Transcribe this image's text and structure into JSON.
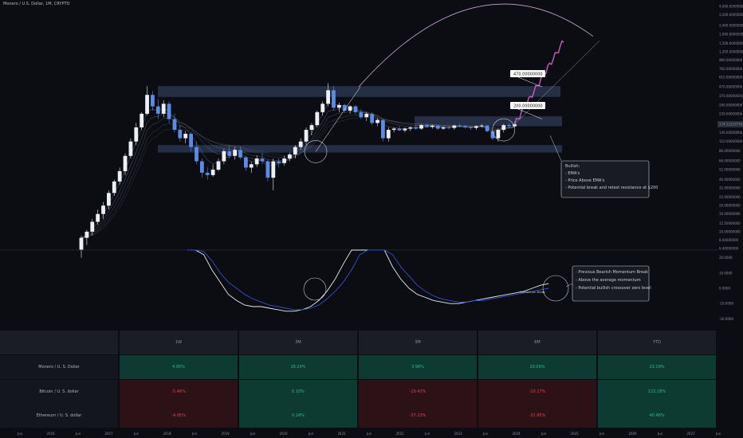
{
  "header": {
    "symbol_label": "Monero / U.S. Dollar, 1M, CRYPTO"
  },
  "chart_data": {
    "type": "candlestick",
    "price_axis_labels": [
      "4,000.00000000",
      "3,200.00000000",
      "2,400.00000000",
      "1,900.00000000",
      "1,500.00000000",
      "1,200.00000000",
      "960.00000000",
      "760.00000000",
      "610.00000000",
      "470.00000000",
      "370.00000000",
      "290.00000000",
      "230.00000000",
      "180.00000000",
      "140.00000000",
      "110.00000000",
      "86.00000000",
      "66.00000000",
      "52.00000000",
      "40.00000000",
      "32.00000000",
      "25.00000000",
      "20.00000000",
      "16.00000000",
      "12.50000000",
      "10.00000000",
      "8.00000000",
      "6.40000000"
    ],
    "current_price_label": "174.11219776",
    "time_axis_labels": [
      "Jun",
      "2016",
      "Jun",
      "2017",
      "Jun",
      "2018",
      "Jun",
      "2019",
      "Jun",
      "2020",
      "Jun",
      "2021",
      "Jun",
      "2022",
      "Jun",
      "2023",
      "Jun",
      "2024",
      "Jun",
      "2025",
      "Jun",
      "2026",
      "Jun",
      "2027",
      "Jun"
    ],
    "levels": [
      {
        "label": "470.00000000",
        "price": 470
      },
      {
        "label": "200.00000000",
        "price": 200
      }
    ],
    "candles": [
      {
        "o": 6.2,
        "h": 9,
        "l": 5,
        "c": 8.5
      },
      {
        "o": 8.5,
        "h": 10.5,
        "l": 7,
        "c": 10
      },
      {
        "o": 10,
        "h": 14,
        "l": 9,
        "c": 13
      },
      {
        "o": 13,
        "h": 18,
        "l": 12,
        "c": 16
      },
      {
        "o": 16,
        "h": 22,
        "l": 14,
        "c": 20
      },
      {
        "o": 20,
        "h": 30,
        "l": 18,
        "c": 28
      },
      {
        "o": 28,
        "h": 40,
        "l": 26,
        "c": 38
      },
      {
        "o": 38,
        "h": 55,
        "l": 35,
        "c": 50
      },
      {
        "o": 50,
        "h": 80,
        "l": 45,
        "c": 75
      },
      {
        "o": 75,
        "h": 120,
        "l": 70,
        "c": 110
      },
      {
        "o": 110,
        "h": 180,
        "l": 100,
        "c": 160
      },
      {
        "o": 160,
        "h": 240,
        "l": 150,
        "c": 230
      },
      {
        "o": 230,
        "h": 480,
        "l": 220,
        "c": 380
      },
      {
        "o": 380,
        "h": 420,
        "l": 250,
        "c": 280
      },
      {
        "o": 280,
        "h": 340,
        "l": 200,
        "c": 230
      },
      {
        "o": 230,
        "h": 330,
        "l": 210,
        "c": 300
      },
      {
        "o": 300,
        "h": 320,
        "l": 180,
        "c": 200
      },
      {
        "o": 200,
        "h": 230,
        "l": 140,
        "c": 150
      },
      {
        "o": 150,
        "h": 170,
        "l": 110,
        "c": 120
      },
      {
        "o": 120,
        "h": 145,
        "l": 105,
        "c": 135
      },
      {
        "o": 135,
        "h": 140,
        "l": 85,
        "c": 95
      },
      {
        "o": 95,
        "h": 110,
        "l": 60,
        "c": 65
      },
      {
        "o": 65,
        "h": 70,
        "l": 42,
        "c": 48
      },
      {
        "o": 48,
        "h": 56,
        "l": 40,
        "c": 45
      },
      {
        "o": 45,
        "h": 60,
        "l": 43,
        "c": 52
      },
      {
        "o": 52,
        "h": 70,
        "l": 50,
        "c": 65
      },
      {
        "o": 65,
        "h": 90,
        "l": 60,
        "c": 85
      },
      {
        "o": 85,
        "h": 100,
        "l": 70,
        "c": 75
      },
      {
        "o": 75,
        "h": 95,
        "l": 68,
        "c": 88
      },
      {
        "o": 88,
        "h": 96,
        "l": 68,
        "c": 72
      },
      {
        "o": 72,
        "h": 76,
        "l": 50,
        "c": 55
      },
      {
        "o": 55,
        "h": 64,
        "l": 48,
        "c": 60
      },
      {
        "o": 60,
        "h": 76,
        "l": 56,
        "c": 70
      },
      {
        "o": 70,
        "h": 82,
        "l": 60,
        "c": 65
      },
      {
        "o": 65,
        "h": 68,
        "l": 38,
        "c": 42
      },
      {
        "o": 42,
        "h": 70,
        "l": 30,
        "c": 65
      },
      {
        "o": 65,
        "h": 70,
        "l": 55,
        "c": 62
      },
      {
        "o": 62,
        "h": 75,
        "l": 58,
        "c": 70
      },
      {
        "o": 70,
        "h": 82,
        "l": 65,
        "c": 78
      },
      {
        "o": 78,
        "h": 100,
        "l": 70,
        "c": 95
      },
      {
        "o": 95,
        "h": 120,
        "l": 88,
        "c": 110
      },
      {
        "o": 110,
        "h": 160,
        "l": 100,
        "c": 150
      },
      {
        "o": 150,
        "h": 180,
        "l": 130,
        "c": 170
      },
      {
        "o": 170,
        "h": 250,
        "l": 160,
        "c": 240
      },
      {
        "o": 240,
        "h": 320,
        "l": 220,
        "c": 300
      },
      {
        "o": 300,
        "h": 520,
        "l": 280,
        "c": 430
      },
      {
        "o": 430,
        "h": 480,
        "l": 250,
        "c": 270
      },
      {
        "o": 270,
        "h": 310,
        "l": 240,
        "c": 290
      },
      {
        "o": 290,
        "h": 300,
        "l": 240,
        "c": 250
      },
      {
        "o": 250,
        "h": 290,
        "l": 230,
        "c": 280
      },
      {
        "o": 280,
        "h": 290,
        "l": 225,
        "c": 240
      },
      {
        "o": 240,
        "h": 260,
        "l": 200,
        "c": 210
      },
      {
        "o": 210,
        "h": 240,
        "l": 190,
        "c": 230
      },
      {
        "o": 230,
        "h": 240,
        "l": 170,
        "c": 180
      },
      {
        "o": 180,
        "h": 205,
        "l": 165,
        "c": 195
      },
      {
        "o": 195,
        "h": 200,
        "l": 110,
        "c": 120
      },
      {
        "o": 120,
        "h": 160,
        "l": 110,
        "c": 150
      },
      {
        "o": 150,
        "h": 160,
        "l": 140,
        "c": 155
      },
      {
        "o": 155,
        "h": 165,
        "l": 145,
        "c": 148
      },
      {
        "o": 148,
        "h": 160,
        "l": 140,
        "c": 155
      },
      {
        "o": 155,
        "h": 165,
        "l": 145,
        "c": 160
      },
      {
        "o": 160,
        "h": 168,
        "l": 150,
        "c": 155
      },
      {
        "o": 155,
        "h": 175,
        "l": 150,
        "c": 170
      },
      {
        "o": 170,
        "h": 178,
        "l": 158,
        "c": 162
      },
      {
        "o": 162,
        "h": 172,
        "l": 155,
        "c": 168
      },
      {
        "o": 168,
        "h": 172,
        "l": 150,
        "c": 155
      },
      {
        "o": 155,
        "h": 165,
        "l": 150,
        "c": 160
      },
      {
        "o": 160,
        "h": 168,
        "l": 152,
        "c": 158
      },
      {
        "o": 158,
        "h": 172,
        "l": 150,
        "c": 168
      },
      {
        "o": 168,
        "h": 176,
        "l": 160,
        "c": 165
      },
      {
        "o": 165,
        "h": 170,
        "l": 155,
        "c": 160
      },
      {
        "o": 160,
        "h": 168,
        "l": 150,
        "c": 158
      },
      {
        "o": 158,
        "h": 170,
        "l": 150,
        "c": 165
      },
      {
        "o": 165,
        "h": 175,
        "l": 158,
        "c": 168
      },
      {
        "o": 168,
        "h": 172,
        "l": 140,
        "c": 145
      },
      {
        "o": 145,
        "h": 150,
        "l": 115,
        "c": 120
      },
      {
        "o": 120,
        "h": 155,
        "l": 110,
        "c": 150
      },
      {
        "o": 150,
        "h": 175,
        "l": 140,
        "c": 170
      },
      {
        "o": 170,
        "h": 180,
        "l": 158,
        "c": 165
      },
      {
        "o": 165,
        "h": 185,
        "l": 160,
        "c": 174
      }
    ],
    "ghost_projection": {
      "from_price": 174,
      "to_price": 1600
    },
    "oscillator_axis_labels": [
      "20.0000",
      "10.0000",
      "0.0000",
      "-10.0000",
      "-20.0000"
    ],
    "table": {
      "columns": [
        "1W",
        "3M",
        "3M",
        "6M",
        "YTD"
      ],
      "rows": [
        {
          "label": "Monero / U. S. Dollar",
          "values": [
            "4.95%",
            "16.24%",
            "3.96%",
            "20.09%",
            "23.19%"
          ],
          "sign": [
            "pos",
            "pos",
            "pos",
            "pos",
            "pos"
          ]
        },
        {
          "label": "Bitcoin / U. S. dollar",
          "values": [
            "-5.46%",
            "6.10%",
            "-19.42%",
            "-10.17%",
            "122.28%"
          ],
          "sign": [
            "neg",
            "pos",
            "neg",
            "neg",
            "pos"
          ]
        },
        {
          "label": "Ethereum / U. S. dollar",
          "values": [
            "-4.05%",
            "0.24%",
            "-37.23%",
            "-31.85%",
            "40.46%"
          ],
          "sign": [
            "neg",
            "pos",
            "neg",
            "neg",
            "pos"
          ]
        }
      ]
    }
  },
  "callouts": {
    "bullish": {
      "title": "Bullish:",
      "lines": [
        "- EMA's",
        "- Price Above EMA's",
        "- Potential break and retest resistance at $200"
      ]
    },
    "momentum": {
      "lines": [
        "- Previous Bearish Momentum Break",
        "- Above the average momentum",
        "- Potential bullish crossover zero level"
      ]
    },
    "momentum_label": "Momentum Break"
  },
  "colors": {
    "bull": "#eceff3",
    "bear": "#5b8be6",
    "projection": "#c25fc4",
    "arc": "#c7a6d3",
    "zone": "#3a4b6f",
    "osc_fast": "#e9ecef",
    "osc_slow": "#3350c9"
  }
}
